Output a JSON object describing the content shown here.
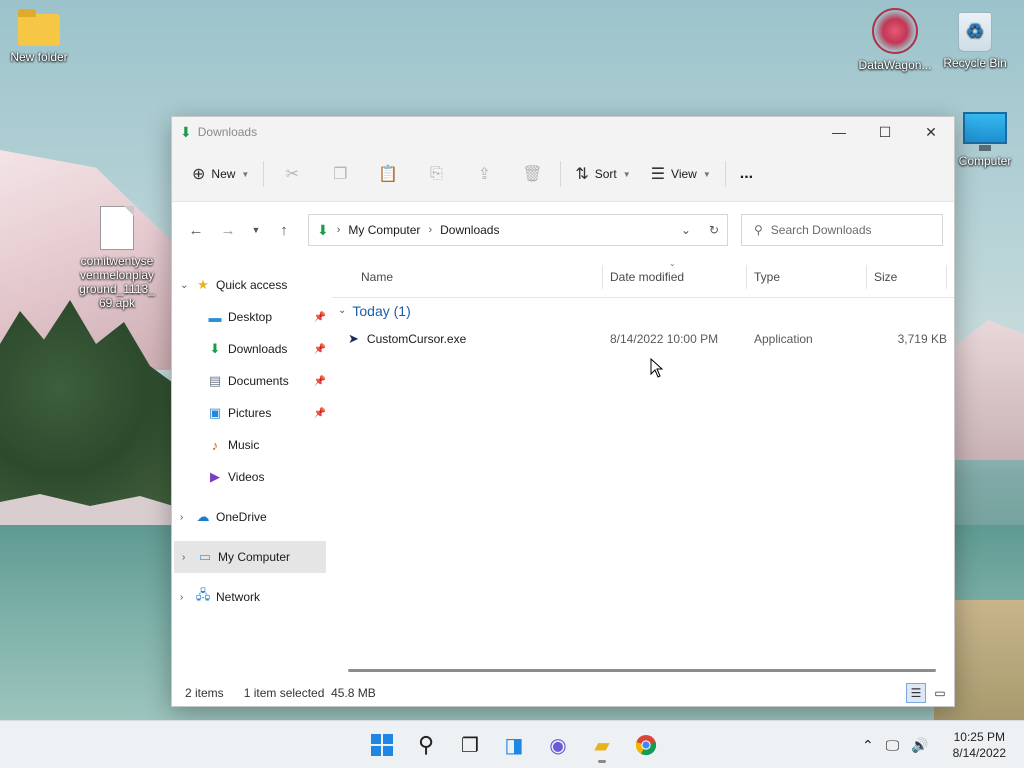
{
  "desktop": {
    "icons": [
      {
        "label": "New folder"
      },
      {
        "label": "comitwentysevenmelonplayground_1113_69.apk"
      },
      {
        "label": "DataWagon..."
      },
      {
        "label": "Recycle Bin"
      },
      {
        "label": "Computer"
      }
    ]
  },
  "window": {
    "title": "Downloads",
    "toolbar": {
      "new_label": "New",
      "sort_label": "Sort",
      "view_label": "View",
      "more_label": "..."
    },
    "address": {
      "crumbs": [
        "My Computer",
        "Downloads"
      ]
    },
    "search": {
      "placeholder": "Search Downloads"
    },
    "sidebar": {
      "quick_access": "Quick access",
      "items": [
        "Desktop",
        "Downloads",
        "Documents",
        "Pictures",
        "Music",
        "Videos"
      ],
      "onedrive": "OneDrive",
      "my_computer": "My Computer",
      "network": "Network"
    },
    "columns": {
      "name": "Name",
      "date": "Date modified",
      "type": "Type",
      "size": "Size"
    },
    "group": {
      "label": "Today (1)"
    },
    "files": [
      {
        "name": "CustomCursor.exe",
        "date": "8/14/2022 10:00 PM",
        "type": "Application",
        "size": "3,719 KB"
      }
    ],
    "status": {
      "items": "2 items",
      "selected": "1 item selected  45.8 MB"
    }
  },
  "taskbar": {
    "time": "10:25 PM",
    "date": "8/14/2022"
  },
  "colors": {
    "accent": "#1e86e3",
    "download_green": "#1a9b4a",
    "group_blue": "#1d5ea8"
  }
}
